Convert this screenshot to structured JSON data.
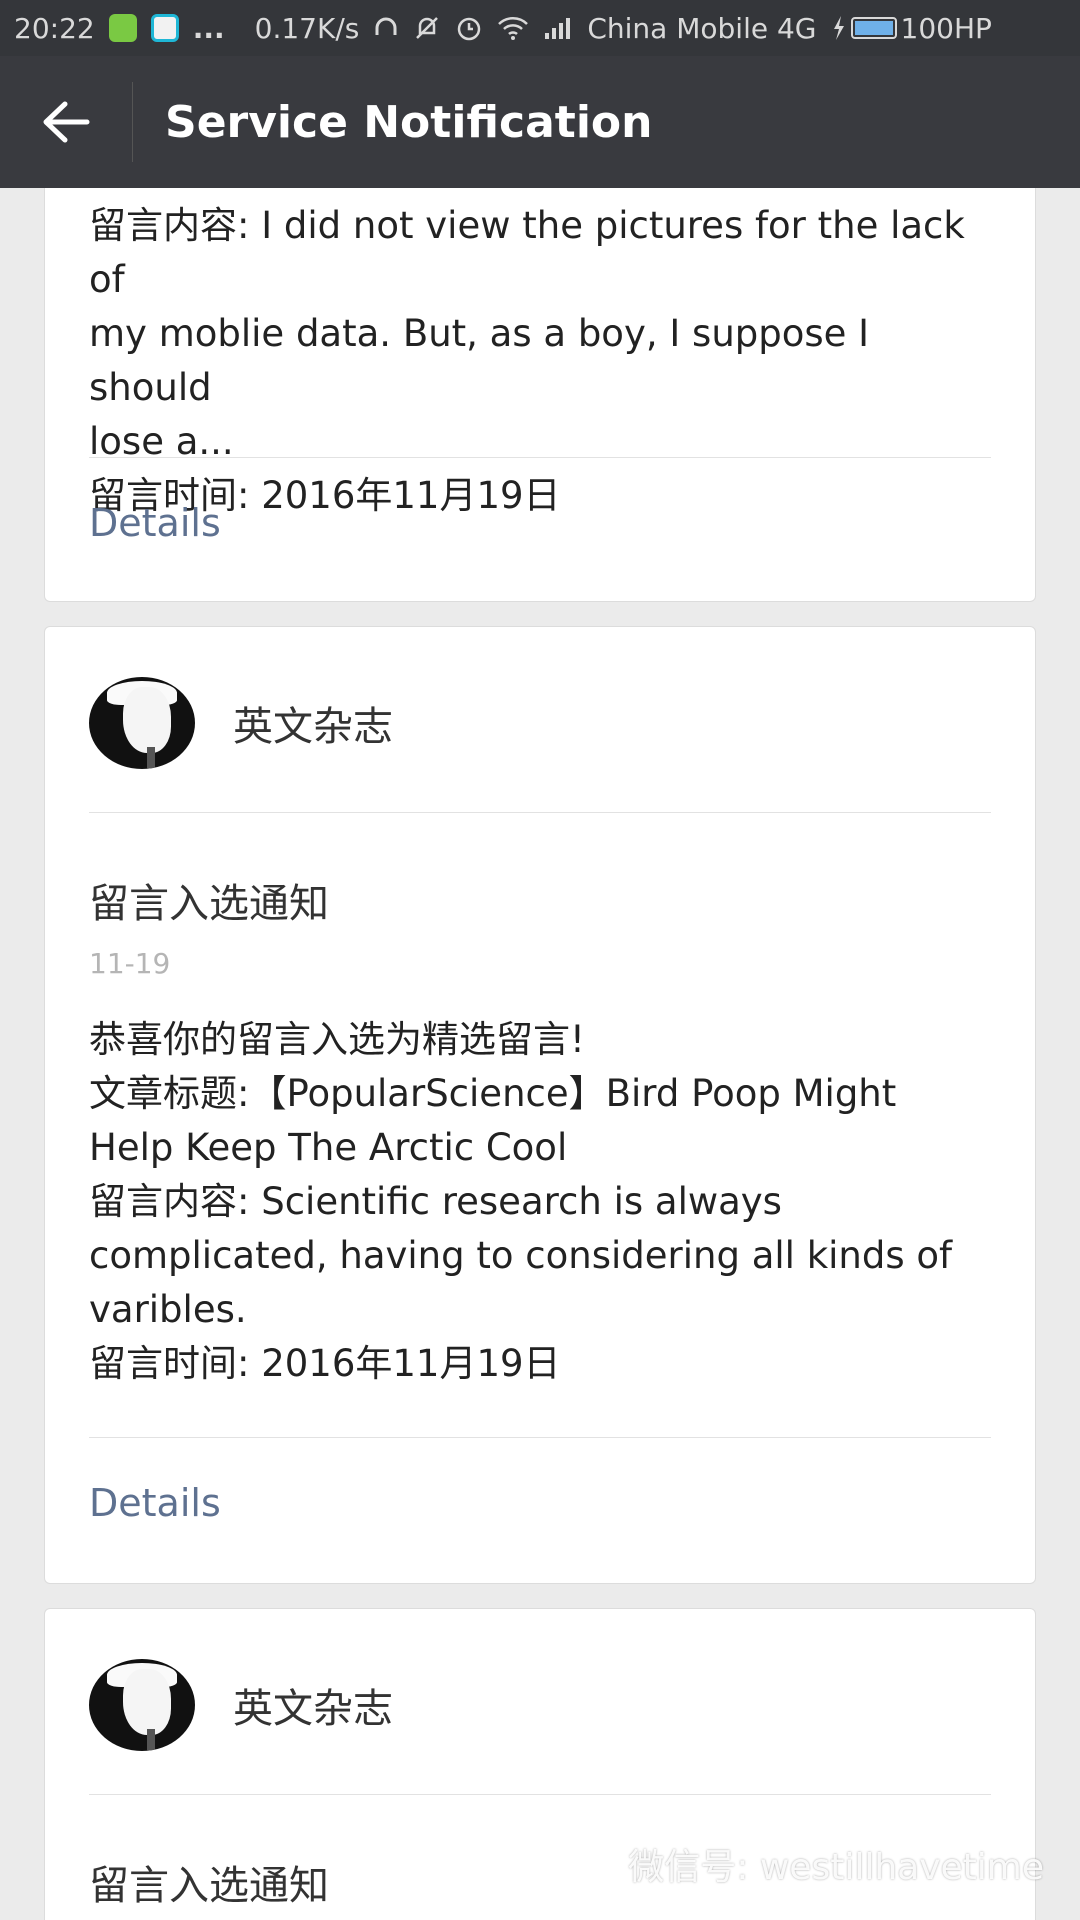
{
  "status_bar": {
    "time": "20:22",
    "speed": "0.17K/s",
    "carrier": "China Mobile 4G",
    "battery": "100HP",
    "ellipsis": "..."
  },
  "nav": {
    "title": "Service Notification"
  },
  "cards": [
    {
      "lines": [
        "留言内容: I did not view the pictures for the lack of",
        "my moblie data. But, as a boy, I suppose I should",
        "lose a...",
        "留言时间: 2016年11月19日"
      ],
      "details": "Details"
    },
    {
      "sender": "英文杂志",
      "title": "留言入选通知",
      "date": "11-19",
      "lines": [
        "恭喜你的留言入选为精选留言!",
        "文章标题:【PopularScience】Bird Poop Might",
        "Help Keep The Arctic Cool",
        "留言内容: Scientific research is always",
        "complicated, having to considering all kinds of",
        "varibles.",
        "留言时间: 2016年11月19日"
      ],
      "details": "Details"
    },
    {
      "sender": "英文杂志",
      "title": "留言入选通知"
    }
  ],
  "watermark": "微信号: westillhavetime"
}
